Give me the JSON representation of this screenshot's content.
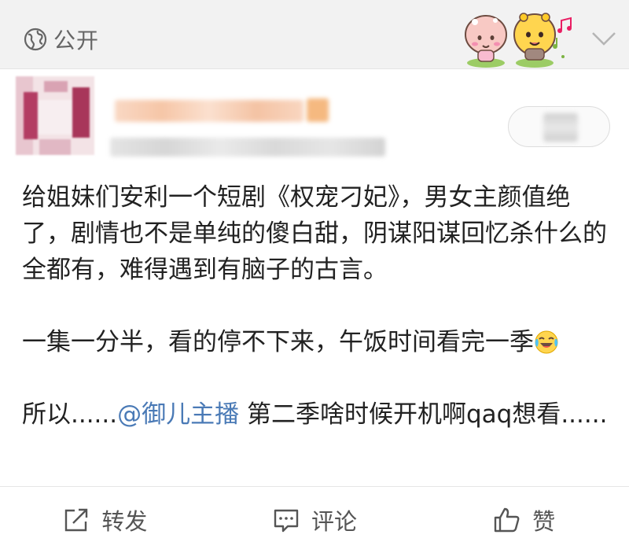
{
  "visibility": {
    "label": "公开",
    "icon": "globe-icon"
  },
  "header": {
    "icons": {
      "decoration": "cartoon-sticker-icon",
      "expand": "chevron-down-icon"
    }
  },
  "post": {
    "paragraphs": [
      {
        "text": "给姐妹们安利一个短剧《权宠刁妃》，男女主颜值绝了，剧情也不是单纯的傻白甜，阴谋阳谋回忆杀什么的全都有，难得遇到有脑子的古言。"
      },
      {
        "text": "一集一分半，看的停不下来，午饭时间看完一季"
      },
      {
        "prefix": "所以......",
        "mention": "@御儿主播",
        "suffix": " 第二季啥时候开机啊qaq想看......"
      }
    ],
    "emoji": "laughing-crying-emoji"
  },
  "actions": [
    {
      "label": "转发",
      "icon": "share-icon"
    },
    {
      "label": "评论",
      "icon": "comment-icon"
    },
    {
      "label": "赞",
      "icon": "thumbs-up-icon"
    }
  ],
  "colors": {
    "mention": "#4a7ab6",
    "topbar_bg": "#f2f2f2",
    "text": "#222222",
    "secondary": "#666666"
  }
}
